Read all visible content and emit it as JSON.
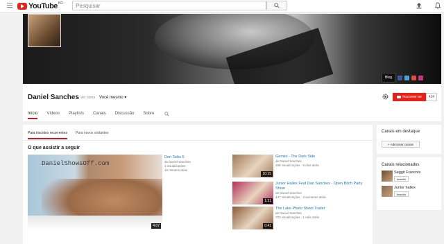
{
  "topbar": {
    "logo_text": "YouTube",
    "logo_region": "BR",
    "search_placeholder": "Pesquisar"
  },
  "channel": {
    "name": "Daniel Sanches",
    "viewing_as_label": "Ver como",
    "viewing_as_value": "Você mesmo",
    "subscribe_label": "Inscrever-se",
    "subscriber_count": "434",
    "blog_label": "Blog",
    "tabs": [
      {
        "label": "Início",
        "active": true
      },
      {
        "label": "Vídeos",
        "active": false
      },
      {
        "label": "Playlists",
        "active": false
      },
      {
        "label": "Canais",
        "active": false
      },
      {
        "label": "Discussão",
        "active": false
      },
      {
        "label": "Sobre",
        "active": false
      }
    ]
  },
  "main": {
    "subtabs": [
      {
        "label": "Para inscritos recorrentes",
        "active": true
      },
      {
        "label": "Para novos visitantes",
        "active": false
      }
    ],
    "section_title": "O que assistir a seguir",
    "featured": {
      "watermark": "DanielShowsOff.com",
      "duration": "4:07",
      "title": "Den Talks 5",
      "channel": "de Daniel Sanches",
      "views": "3 visualizações",
      "age": "15 minutos atrás"
    },
    "videos": [
      {
        "title": "Gemini - The Dark Side",
        "channel": "de Daniel Sanches",
        "meta": "288 visualizações · 6 dias atrás",
        "duration": "10:15",
        "thumb_color": "#a07a5a"
      },
      {
        "title": "Junior Hallex Feat Dan Sanches - Open Bitch Party Show",
        "channel": "de Daniel Sanches",
        "meta": "447 visualizações · 3 semanas atrás",
        "duration": "1:31",
        "thumb_color": "#b0305a"
      },
      {
        "title": "The Lake Photo Shoot Trailer",
        "channel": "de Daniel Sanches",
        "meta": "703 visualizações · 1 mês atrás",
        "duration": "0:41",
        "thumb_color": "#8a5a3a"
      }
    ]
  },
  "sidebar": {
    "featured_title": "Canais em destaque",
    "add_channels_label": "+ Adicionar canais",
    "related_title": "Canais relacionados",
    "related": [
      {
        "name": "Saggit Francois",
        "sub_label": "Inscrito"
      },
      {
        "name": "Junior hallex",
        "sub_label": "Inscrito"
      }
    ]
  },
  "colors": {
    "accent_red": "#e62117",
    "link_blue": "#167ac6"
  }
}
